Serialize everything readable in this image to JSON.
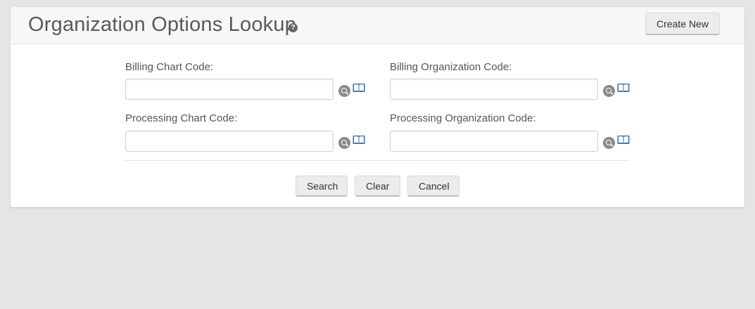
{
  "header": {
    "title": "Organization Options Lookup",
    "help_glyph": "?",
    "help_icon": "question-circle-icon",
    "create_new_label": "Create New"
  },
  "form": {
    "fields": [
      {
        "label": "Billing Chart Code:",
        "value": "",
        "lookup_icon": "search-icon",
        "direct_inquiry_icon": "book-icon"
      },
      {
        "label": "Billing Organization Code:",
        "value": "",
        "lookup_icon": "search-icon",
        "direct_inquiry_icon": "book-icon"
      },
      {
        "label": "Processing Chart Code:",
        "value": "",
        "lookup_icon": "search-icon",
        "direct_inquiry_icon": "book-icon"
      },
      {
        "label": "Processing Organization Code:",
        "value": "",
        "lookup_icon": "search-icon",
        "direct_inquiry_icon": "book-icon"
      }
    ]
  },
  "actions": {
    "search_label": "Search",
    "clear_label": "Clear",
    "cancel_label": "Cancel"
  },
  "colors": {
    "background": "#e5e5e5",
    "panel": "#ffffff",
    "header": "#f7f7f7",
    "button": "#ececec",
    "book_blue": "#3b6ea8"
  }
}
